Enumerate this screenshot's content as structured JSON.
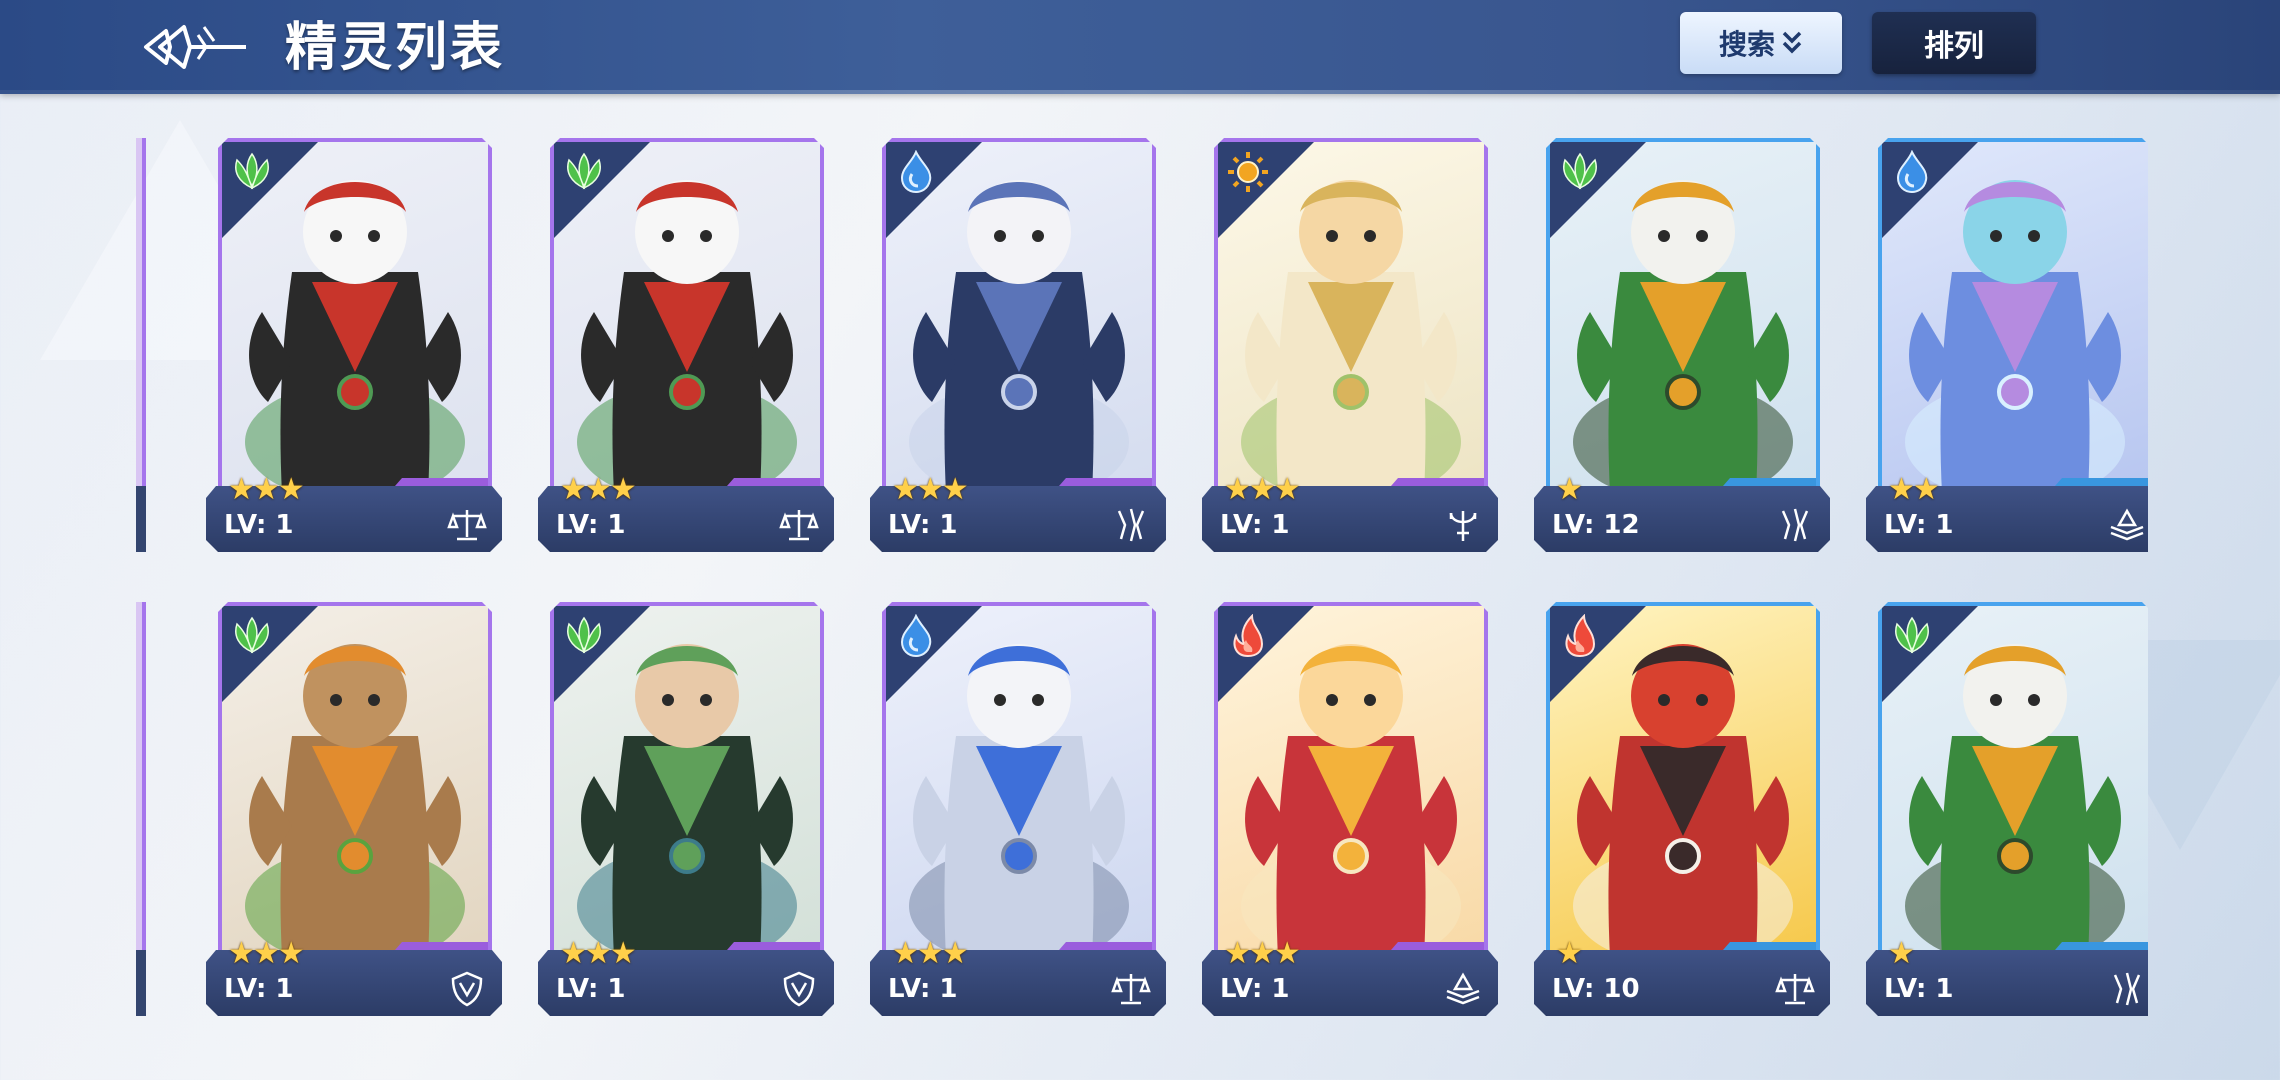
{
  "header": {
    "title": "精灵列表",
    "search_label": "搜索",
    "sort_label": "排列"
  },
  "spirits": [
    {
      "element": "leaf",
      "stars": "★★★",
      "level": "LV: 1",
      "role": "scales",
      "rarity": "purple",
      "art": "panda"
    },
    {
      "element": "leaf",
      "stars": "★★★",
      "level": "LV: 1",
      "role": "scales",
      "rarity": "purple",
      "art": "panda"
    },
    {
      "element": "water",
      "stars": "★★★",
      "level": "LV: 1",
      "role": "claw",
      "rarity": "purple",
      "art": "silver-warrior"
    },
    {
      "element": "light",
      "stars": "★★★",
      "level": "LV: 1",
      "role": "trident",
      "rarity": "purple",
      "art": "forest-elf"
    },
    {
      "element": "leaf",
      "stars": "★",
      "level": "LV: 12",
      "role": "claw",
      "rarity": "blue",
      "art": "green-beast"
    },
    {
      "element": "water",
      "stars": "★★",
      "level": "LV: 1",
      "role": "book",
      "rarity": "blue",
      "art": "blue-maiden"
    },
    {
      "element": "leaf",
      "stars": "★★★",
      "level": "LV: 1",
      "role": "shield",
      "rarity": "purple",
      "art": "tree-golem"
    },
    {
      "element": "leaf",
      "stars": "★★★",
      "level": "LV: 1",
      "role": "shield",
      "rarity": "purple",
      "art": "green-swordsman"
    },
    {
      "element": "water",
      "stars": "★★★",
      "level": "LV: 1",
      "role": "scales",
      "rarity": "purple",
      "art": "ice-knight"
    },
    {
      "element": "fire",
      "stars": "★★★",
      "level": "LV: 1",
      "role": "book",
      "rarity": "purple",
      "art": "phoenix-girl"
    },
    {
      "element": "fire",
      "stars": "★",
      "level": "LV: 10",
      "role": "scales",
      "rarity": "blue",
      "art": "red-dragon"
    },
    {
      "element": "leaf",
      "stars": "★",
      "level": "LV: 1",
      "role": "claw",
      "rarity": "blue",
      "art": "green-beast"
    }
  ],
  "colors": {
    "leaf": "#4fc14a",
    "water": "#3b8fe6",
    "light": "#f2a521",
    "fire": "#ee4a3a",
    "purple_frame": "#a575ec",
    "blue_frame": "#48a3ee",
    "star": "#ffd04a"
  }
}
